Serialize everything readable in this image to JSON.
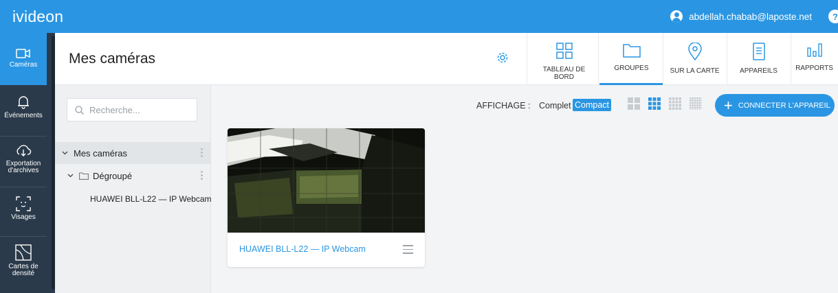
{
  "app": {
    "brand": "ivideon",
    "account_email": "abdellah.chabab@laposte.net",
    "help_label": "?"
  },
  "leftnav": {
    "items": [
      {
        "label": "Caméras",
        "icon": "camera-icon",
        "active": true
      },
      {
        "label": "Événements",
        "icon": "bell-icon"
      },
      {
        "label": "Exportation d'archives",
        "line1": "Exportation",
        "line2": "d'archives",
        "icon": "cloud-download-icon"
      },
      {
        "label": "Visages",
        "icon": "face-icon"
      },
      {
        "label": "Cartes de densité",
        "line1": "Cartes de",
        "line2": "densité",
        "icon": "heatmap-icon"
      }
    ]
  },
  "header": {
    "title": "Mes caméras",
    "settings_icon": "gear-icon",
    "tools": [
      {
        "label": "TABLEAU DE BORD",
        "icon": "dashboard-icon"
      },
      {
        "label": "GROUPES",
        "icon": "folder-icon",
        "active": true
      },
      {
        "label": "SUR LA CARTE",
        "icon": "map-pin-icon"
      },
      {
        "label": "APPAREILS",
        "icon": "device-icon"
      },
      {
        "label": "RAPPORTS",
        "icon": "bar-chart-icon"
      }
    ]
  },
  "sidebar": {
    "search_placeholder": "Recherche...",
    "tree": {
      "root": "Mes caméras",
      "group": "Dégroupé",
      "camera": "HUAWEI BLL-L22 — IP Webcam"
    }
  },
  "main": {
    "display_label": "AFFICHAGE :",
    "mode_full": "Complet",
    "mode_compact": "Compact",
    "connect_button": "CONNECTER L'APPAREIL",
    "card": {
      "title": "HUAWEI BLL-L22 — IP Webcam"
    }
  },
  "colors": {
    "accent": "#2a96e3",
    "nav_bg": "#2b3a4a",
    "camera_online": "#2ecc71"
  }
}
